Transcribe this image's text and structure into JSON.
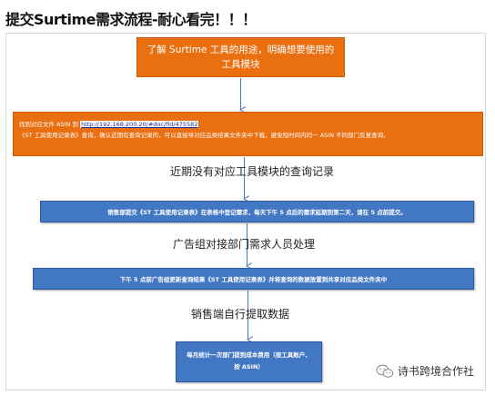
{
  "title": "提交Surtime需求流程-耐心看完！！！",
  "steps": {
    "step1": {
      "line1": "了解 Surtime 工具的用途，明确想要使用的",
      "line2": "工具模块"
    },
    "step2": {
      "prefix": "找到对应文件 ASIN 到 ",
      "link": "http://192.168.200.20/#doc/fid/475582",
      "line2": "《ST 工具使用记录表》查询，确认近期有查询记录的，可以直接导对应品类结果文件夹中下载，避免短时间内同一 ASIN 不同部门反复查询。"
    },
    "step3": "销售部提交《ST 工具使用记录表》在表格中登记需求，每天下午 5 点后的需求延期到第二天，请在 5 点前提交。",
    "step4": "下午 5 点前广告组更新查询结果《ST 工具使用记录表》并将查询的数据放置到共享对应品类文件夹中",
    "step5": {
      "line1": "每月统计一次部门提到成本费用（按工具账户、",
      "line2": "按 ASIN）"
    }
  },
  "labels": {
    "after2": "近期没有对应工具模块的查询记录",
    "after3": "广告组对接部门需求人员处理",
    "after4": "销售端自行提取数据"
  },
  "watermark": {
    "text": "诗书跨境合作社",
    "icon": "wechat-icon"
  },
  "colors": {
    "orange": "#ea6f10",
    "blue": "#4277c4",
    "arrow": "#4a74b8"
  }
}
